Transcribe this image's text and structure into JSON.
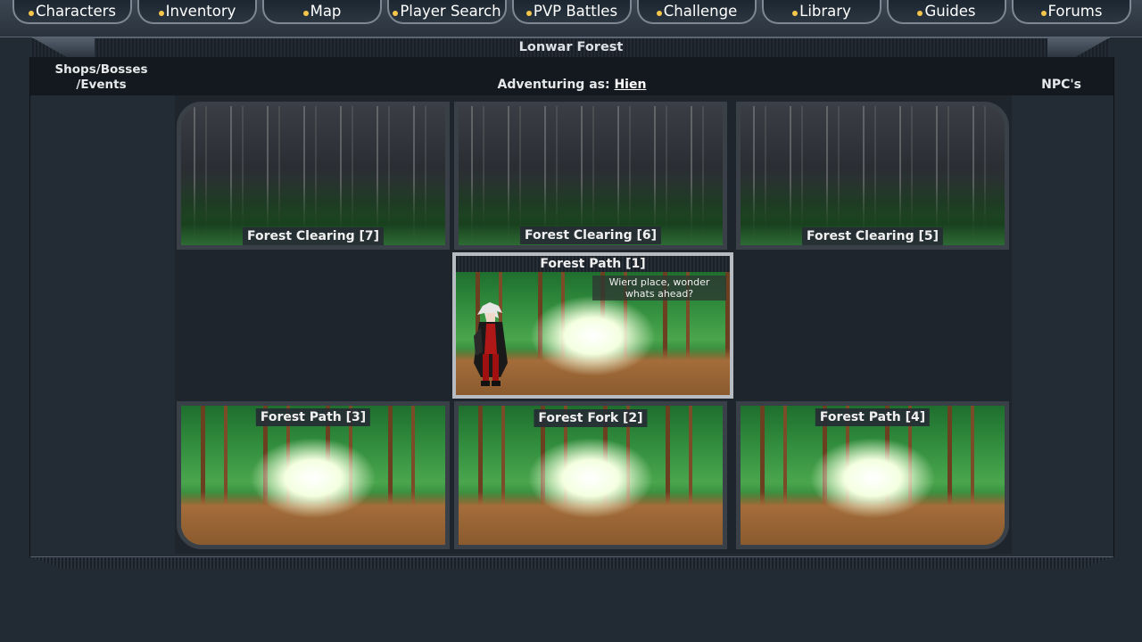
{
  "nav": {
    "items": [
      {
        "label": "Characters"
      },
      {
        "label": "Inventory"
      },
      {
        "label": "Map"
      },
      {
        "label": "Player Search"
      },
      {
        "label": "PVP Battles"
      },
      {
        "label": "Challenge"
      },
      {
        "label": "Library"
      },
      {
        "label": "Guides"
      },
      {
        "label": "Forums"
      }
    ]
  },
  "area": {
    "title": "Lonwar Forest"
  },
  "header": {
    "shops_label": "Shops/Bosses /Events",
    "adventuring_prefix": "Adventuring as:",
    "character_name": "Hien",
    "npc_label": "NPC's"
  },
  "locations": {
    "top": [
      {
        "label": "Forest Clearing [7]"
      },
      {
        "label": "Forest Clearing [6]"
      },
      {
        "label": "Forest Clearing [5]"
      }
    ],
    "current": {
      "label": "Forest Path [1]",
      "flavor": "Wierd place, wonder whats ahead?"
    },
    "bottom": [
      {
        "label": "Forest Path [3]"
      },
      {
        "label": "Forest Fork [2]"
      },
      {
        "label": "Forest Path [4]"
      }
    ]
  },
  "colors": {
    "nav_dot": "#f6c64a",
    "background": "#222b34"
  }
}
